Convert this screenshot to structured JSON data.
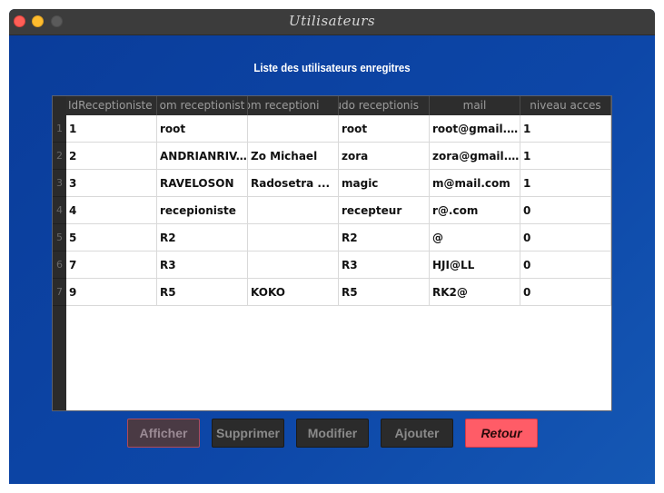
{
  "window": {
    "title": "Utilisateurs"
  },
  "heading": "Liste des utilisateurs enregitres",
  "table": {
    "columns": [
      "IdReceptioniste",
      "om receptionist",
      "nom receptioni",
      "eudo receptionis",
      "mail",
      "niveau acces"
    ],
    "rows": [
      {
        "num": "1",
        "cells": [
          "1",
          "root",
          "",
          "root",
          "root@gmail.c...",
          "1"
        ]
      },
      {
        "num": "2",
        "cells": [
          "2",
          "ANDRIANRIV...",
          "Zo Michael",
          "zora",
          "zora@gmail....",
          "1"
        ]
      },
      {
        "num": "3",
        "cells": [
          "3",
          "RAVELOSON",
          "Radosetra ...",
          "magic",
          "m@mail.com",
          "1"
        ]
      },
      {
        "num": "4",
        "cells": [
          "4",
          "recepioniste",
          "",
          "recepteur",
          "r@.com",
          "0"
        ]
      },
      {
        "num": "5",
        "cells": [
          "5",
          "R2",
          "",
          "R2",
          "@",
          "0"
        ]
      },
      {
        "num": "6",
        "cells": [
          "7",
          "R3",
          "",
          "R3",
          "HJI@LL",
          "0"
        ]
      },
      {
        "num": "7",
        "cells": [
          "9",
          "R5",
          "KOKO",
          "R5",
          "RK2@",
          "0"
        ]
      }
    ]
  },
  "buttons": {
    "afficher": "Afficher",
    "supprimer": "Supprimer",
    "modifier": "Modifier",
    "ajouter": "Ajouter",
    "retour": "Retour"
  }
}
